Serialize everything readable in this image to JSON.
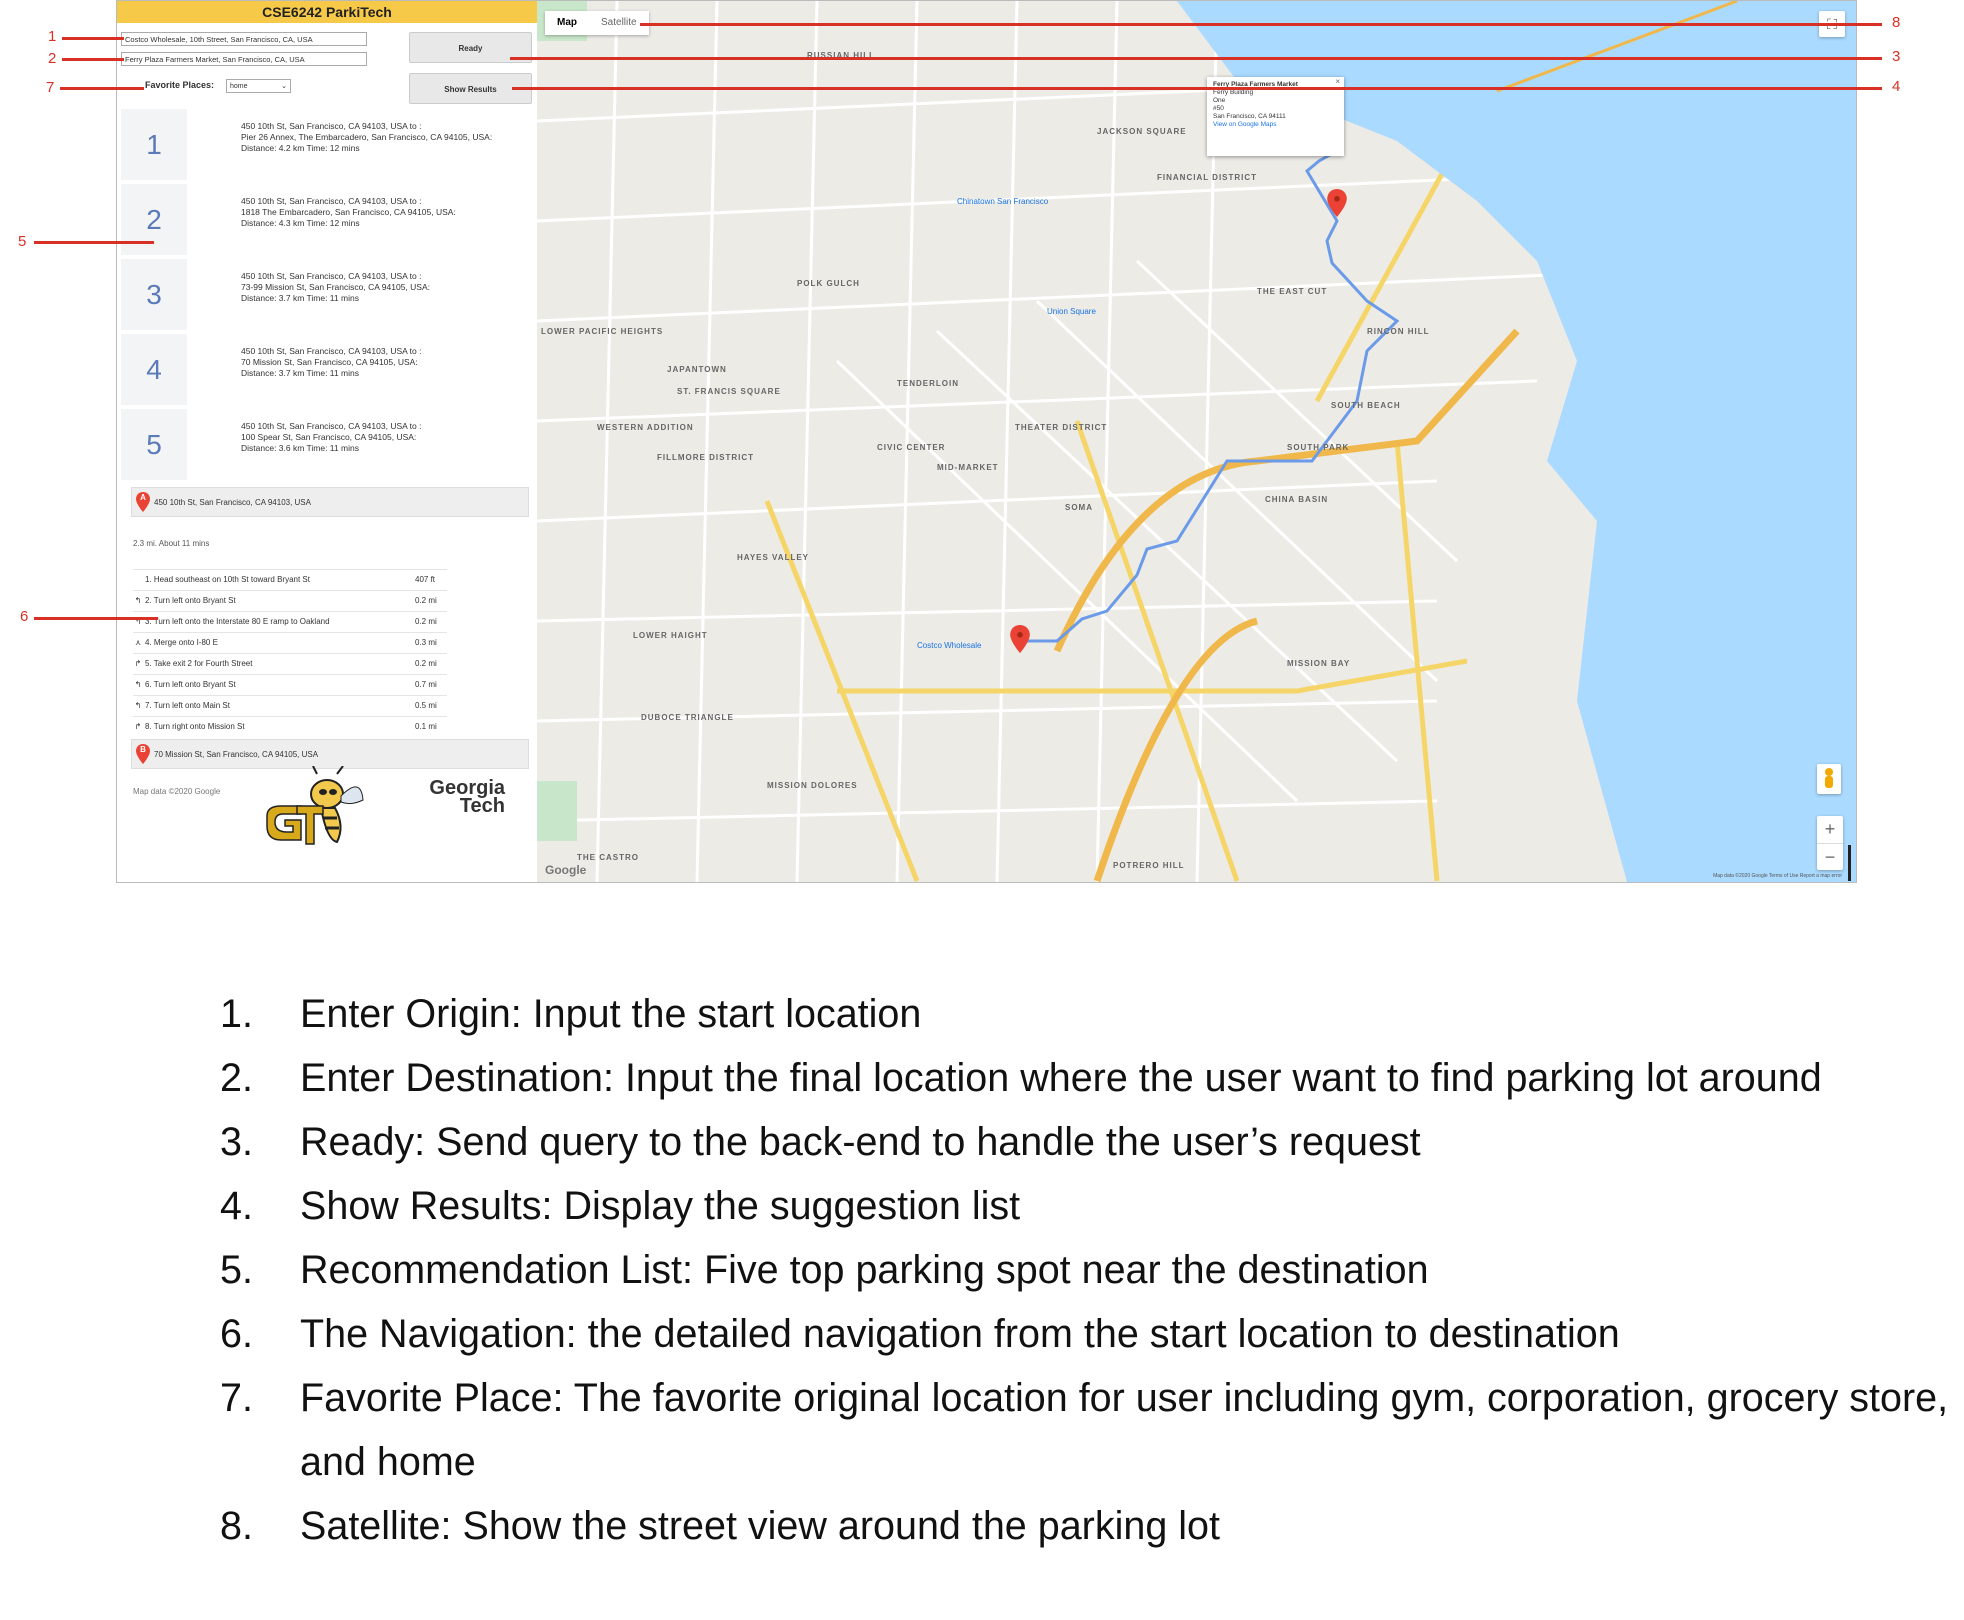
{
  "app": {
    "title": "CSE6242 ParkiTech",
    "origin_input": "Costco Wholesale, 10th Street, San Francisco, CA, USA",
    "destination_input": "Ferry Plaza Farmers Market, San Francisco, CA, USA",
    "ready_button": "Ready",
    "show_results_button": "Show Results",
    "favorite_label": "Favorite Places:",
    "favorite_selected": "home",
    "recommendations": [
      {
        "num": "1",
        "line1": "450 10th St, San Francisco, CA 94103, USA to :",
        "line2": "Pier 26 Annex, The Embarcadero, San Francisco, CA 94105, USA:",
        "line3": "Distance: 4.2 km Time: 12 mins"
      },
      {
        "num": "2",
        "line1": "450 10th St, San Francisco, CA 94103, USA to :",
        "line2": "1818 The Embarcadero, San Francisco, CA 94105, USA:",
        "line3": "Distance: 4.3 km Time: 12 mins"
      },
      {
        "num": "3",
        "line1": "450 10th St, San Francisco, CA 94103, USA to :",
        "line2": "73-99 Mission St, San Francisco, CA 94105, USA:",
        "line3": "Distance: 3.7 km Time: 11 mins"
      },
      {
        "num": "4",
        "line1": "450 10th St, San Francisco, CA 94103, USA to :",
        "line2": "70 Mission St, San Francisco, CA 94105, USA:",
        "line3": "Distance: 3.7 km Time: 11 mins"
      },
      {
        "num": "5",
        "line1": "450 10th St, San Francisco, CA 94103, USA to :",
        "line2": "100 Spear St, San Francisco, CA 94105, USA:",
        "line3": "Distance: 3.6 km Time: 11 mins"
      }
    ],
    "start_marker": "A",
    "start_address": "450 10th St, San Francisco, CA 94103, USA",
    "route_summary": "2.3 mi. About 11 mins",
    "steps": [
      {
        "icon": "",
        "text": "1. Head southeast on 10th St toward Bryant St",
        "dist": "407 ft"
      },
      {
        "icon": "↰",
        "text": "2. Turn left onto Bryant St",
        "dist": "0.2 mi"
      },
      {
        "icon": "↰",
        "text": "3. Turn left onto the Interstate 80 E ramp to Oakland",
        "dist": "0.2 mi"
      },
      {
        "icon": "⋏",
        "text": "4. Merge onto I-80 E",
        "dist": "0.3 mi"
      },
      {
        "icon": "↱",
        "text": "5. Take exit 2 for Fourth Street",
        "dist": "0.2 mi"
      },
      {
        "icon": "↰",
        "text": "6. Turn left onto Bryant St",
        "dist": "0.7 mi"
      },
      {
        "icon": "↰",
        "text": "7. Turn left onto Main St",
        "dist": "0.5 mi"
      },
      {
        "icon": "↱",
        "text": "8. Turn right onto Mission St",
        "dist": "0.1 mi"
      }
    ],
    "end_marker": "B",
    "end_address": "70 Mission St, San Francisco, CA 94105, USA",
    "map_credit": "Map data ©2020 Google",
    "gt_word1": "Georgia",
    "gt_word2": "Tech"
  },
  "map": {
    "tab_map": "Map",
    "tab_satellite": "Satellite",
    "infowindow": {
      "title": "Ferry Plaza Farmers Market",
      "line1": "Ferry Building",
      "line2": "One",
      "line3": "#50",
      "line4": "San Francisco, CA 94111",
      "link": "View on Google Maps"
    },
    "labels": {
      "russian_hill": "RUSSIAN HILL",
      "jackson_square": "JACKSON SQUARE",
      "financial_district": "FINANCIAL DISTRICT",
      "polk_gulch": "POLK GULCH",
      "the_east_cut": "THE EAST CUT",
      "rincon_hill": "RINCON HILL",
      "japantown": "JAPANTOWN",
      "tenderloin": "TENDERLOIN",
      "south_beach": "SOUTH BEACH",
      "civic_center": "CIVIC CENTER",
      "theater_district": "THEATER DISTRICT",
      "south_park": "SOUTH PARK",
      "mid_market": "MID-MARKET",
      "soma": "SOMA",
      "china_basin": "CHINA BASIN",
      "hayes_valley": "HAYES VALLEY",
      "lower_haight": "LOWER HAIGHT",
      "mission_bay": "MISSION BAY",
      "duboce_triangle": "DUBOCE TRIANGLE",
      "mission_dolores": "MISSION DOLORES",
      "the_castro": "THE CASTRO",
      "potrero_hill": "POTRERO HILL",
      "western_addition": "WESTERN ADDITION",
      "lower_pacific_heights": "LOWER PACIFIC HEIGHTS",
      "st_francis_square": "ST. FRANCIS SQUARE",
      "fillmore_district": "FILLMORE DISTRICT",
      "costco": "Costco Wholesale",
      "union_square": "Union Square",
      "chinatown": "Chinatown San Francisco"
    },
    "google_logo": "Google",
    "map_data": "Map data ©2020 Google  Terms of Use  Report a map error",
    "zoom_in": "+",
    "zoom_out": "−",
    "water_color": "#aadaff",
    "route_color": "#6b9ae8",
    "freeway_color": "#f6d568"
  },
  "callouts": [
    "1",
    "2",
    "7",
    "5",
    "6",
    "8",
    "3",
    "4"
  ],
  "legend": [
    {
      "num": "1.",
      "text": "Enter Origin: Input the start location"
    },
    {
      "num": "2.",
      "text": "Enter Destination: Input the final location where the user want to find parking lot around"
    },
    {
      "num": "3.",
      "text": "Ready: Send query to the back-end to handle the user’s request"
    },
    {
      "num": "4.",
      "text": "Show Results: Display the suggestion list"
    },
    {
      "num": "5.",
      "text": "Recommendation List: Five top parking spot near the destination"
    },
    {
      "num": "6.",
      "text": "The Navigation: the detailed navigation from the start location to destination"
    },
    {
      "num": "7.",
      "text": "Favorite Place: The favorite original location for user including gym, corporation, grocery store, and home"
    },
    {
      "num": "8.",
      "text": "Satellite: Show the street view around the parking lot"
    }
  ]
}
